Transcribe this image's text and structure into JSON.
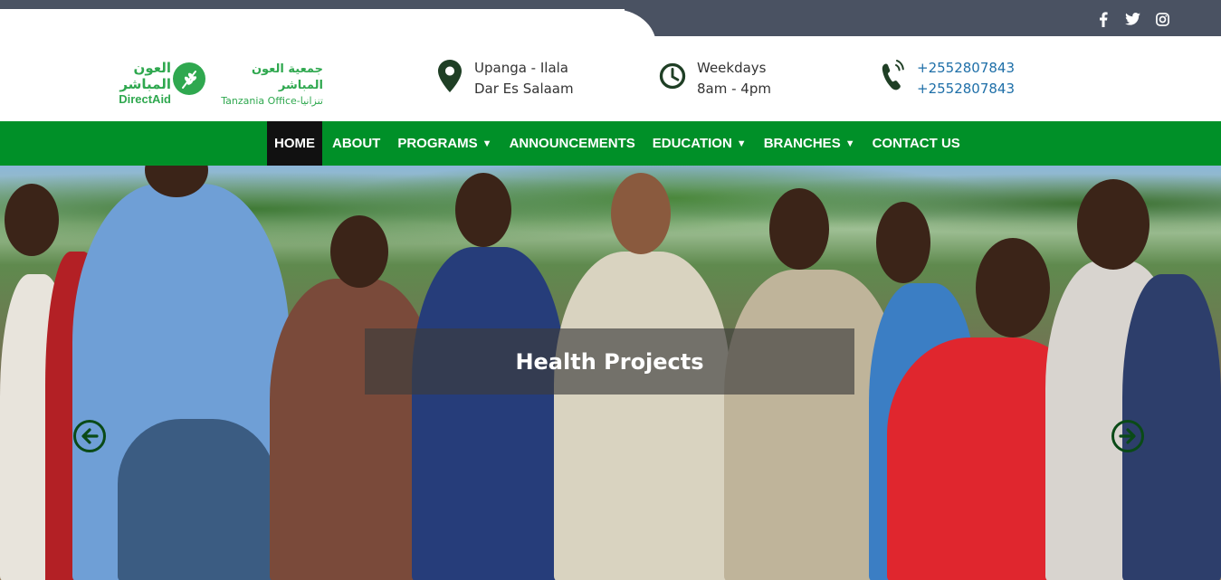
{
  "social": {
    "icons": [
      "facebook-icon",
      "twitter-icon",
      "instagram-icon"
    ]
  },
  "logo": {
    "arabic_left": "العون المباشر",
    "english_name": "DirectAid",
    "arabic_right": "جمعية العون المباشر",
    "office_line": "Tanzania Office-تنزانيا"
  },
  "contact": {
    "address_line1": "Upanga - Ilala",
    "address_line2": "Dar Es Salaam",
    "hours_line1": "Weekdays",
    "hours_line2": "8am - 4pm",
    "phone1": "+2552807843",
    "phone2": "+2552807843"
  },
  "nav": {
    "items": [
      {
        "label": "HOME",
        "active": true,
        "dropdown": false
      },
      {
        "label": "ABOUT",
        "active": false,
        "dropdown": false
      },
      {
        "label": "PROGRAMS",
        "active": false,
        "dropdown": true
      },
      {
        "label": "ANNOUNCEMENTS",
        "active": false,
        "dropdown": false
      },
      {
        "label": "EDUCATION",
        "active": false,
        "dropdown": true
      },
      {
        "label": "BRANCHES",
        "active": false,
        "dropdown": true
      },
      {
        "label": "CONTACT US",
        "active": false,
        "dropdown": false
      }
    ],
    "caret": "▼"
  },
  "hero": {
    "caption": "Health Projects"
  },
  "colors": {
    "brand_green": "#009028",
    "logo_green": "#2fa84f",
    "topbar_dark": "#4a5262",
    "phone_blue": "#1e6fa8",
    "arrow_green": "#0a4a17"
  }
}
